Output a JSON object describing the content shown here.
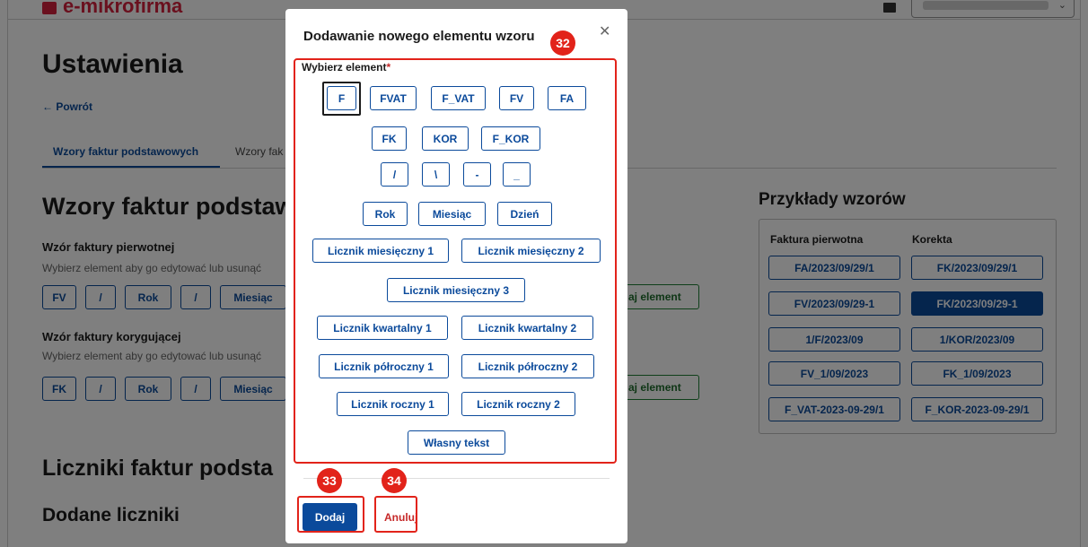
{
  "app": {
    "logo_text": "e-mikrofirma"
  },
  "page": {
    "title": "Ustawienia",
    "back_link": "← Powrót",
    "tabs": [
      "Wzory faktur podstawowych",
      "Wzory fak"
    ],
    "section_title": "Wzory faktur podstaw",
    "original": {
      "label": "Wzór faktury pierwotnej",
      "hint": "Wybierz element aby go edytować lub usunąć",
      "chips": [
        "FV",
        "/",
        "Rok",
        "/",
        "Miesiąc"
      ],
      "add_label": "aj element"
    },
    "correction": {
      "label": "Wzór faktury korygującej",
      "hint": "Wybierz element aby go edytować lub usunąć",
      "chips": [
        "FK",
        "/",
        "Rok",
        "/",
        "Miesiąc"
      ],
      "add_label": "aj element"
    },
    "counters_title": "Liczniki faktur podsta",
    "added_counters_title": "Dodane liczniki"
  },
  "examples": {
    "title": "Przykłady wzorów",
    "col1_header": "Faktura pierwotna",
    "col2_header": "Korekta",
    "rows": [
      [
        "FA/2023/09/29/1",
        "FK/2023/09/29/1"
      ],
      [
        "FV/2023/09/29-1",
        "FK/2023/09/29-1"
      ],
      [
        "1/F/2023/09",
        "1/KOR/2023/09"
      ],
      [
        "FV_1/09/2023",
        "FK_1/09/2023"
      ],
      [
        "F_VAT-2023-09-29/1",
        "F_KOR-2023-09-29/1"
      ]
    ],
    "selected": "FK/2023/09/29-1"
  },
  "modal": {
    "title": "Dodawanie nowego elementu wzoru",
    "close_icon": "close-icon",
    "field_label": "Wybierz element",
    "required_mark": "*",
    "elements": {
      "r1": [
        "F",
        "FVAT",
        "F_VAT",
        "FV",
        "FA"
      ],
      "r2": [
        "FK",
        "KOR",
        "F_KOR"
      ],
      "r3": [
        "/",
        "\\",
        "-",
        "_"
      ],
      "r4": [
        "Rok",
        "Miesiąc",
        "Dzień"
      ],
      "r5": [
        "Licznik miesięczny 1",
        "Licznik miesięczny 2"
      ],
      "r6": [
        "Licznik miesięczny 3"
      ],
      "r7": [
        "Licznik kwartalny 1",
        "Licznik kwartalny 2"
      ],
      "r8": [
        "Licznik półroczny 1",
        "Licznik półroczny 2"
      ],
      "r9": [
        "Licznik roczny 1",
        "Licznik roczny 2"
      ],
      "r10": [
        "Własny tekst"
      ]
    },
    "focused_element": "F",
    "submit_label": "Dodaj",
    "cancel_label": "Anuluj"
  },
  "annotations": {
    "badges": [
      "32",
      "33",
      "34"
    ],
    "color": "#e2231a"
  },
  "colors": {
    "primary": "#0b4a9b",
    "brand": "#d4213d",
    "success": "#1e7e34"
  }
}
